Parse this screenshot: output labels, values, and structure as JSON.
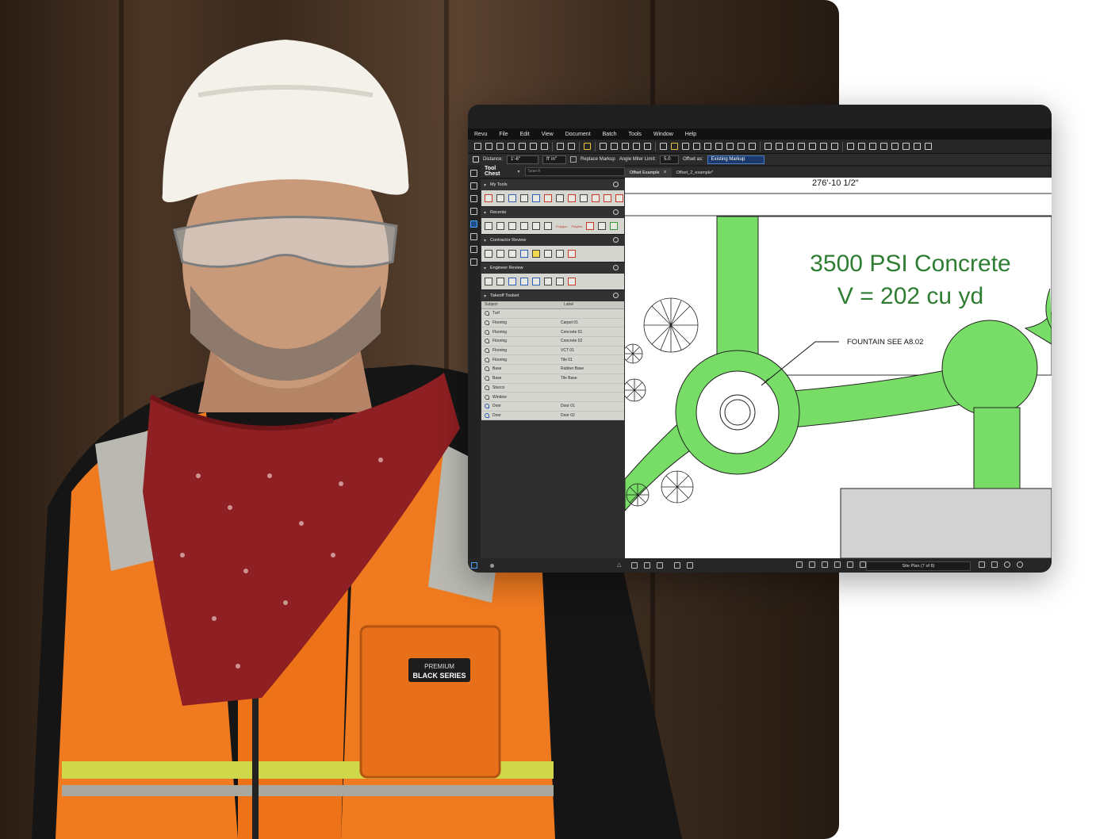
{
  "menu": [
    "Revu",
    "File",
    "Edit",
    "View",
    "Document",
    "Batch",
    "Tools",
    "Window",
    "Help"
  ],
  "options_bar": {
    "distance_label": "Distance:",
    "distance_value": "1'-6\"",
    "unit_value": "ft' in\"",
    "replace_markup_label": "Replace Markup",
    "angle_miter_label": "Angle Miter Limit:",
    "angle_miter_value": "5.0",
    "offset_as_label": "Offset as:",
    "offset_as_value": "Existing Markup"
  },
  "tool_chest": {
    "title": "Tool Chest",
    "search_placeholder": "Search",
    "sections": {
      "my_tools": "My Tools",
      "recents": "Recents",
      "contractor_review": "Contractor Review",
      "engineer_review": "Engineer Review",
      "takeoff_toolset": "Takeoff Toolset"
    },
    "recents_labels": [
      "Polygon",
      "Polyline"
    ],
    "takeoff_columns": [
      "Subject",
      "Label"
    ],
    "takeoff_rows": [
      {
        "subject": "Turf",
        "label": ""
      },
      {
        "subject": "Flooring",
        "label": "Carpet 01"
      },
      {
        "subject": "Flooring",
        "label": "Concrete 01"
      },
      {
        "subject": "Flooring",
        "label": "Concrete 02"
      },
      {
        "subject": "Flooring",
        "label": "VCT 01"
      },
      {
        "subject": "Flooring",
        "label": "Tile 01"
      },
      {
        "subject": "Base",
        "label": "Rubber Base"
      },
      {
        "subject": "Base",
        "label": "Tile Base"
      },
      {
        "subject": "Stucco",
        "label": ""
      },
      {
        "subject": "Window",
        "label": ""
      },
      {
        "subject": "Door",
        "label": "Door 01"
      },
      {
        "subject": "Door",
        "label": "Door 02"
      }
    ]
  },
  "tabs": [
    {
      "label": "Offset Example",
      "active": true
    },
    {
      "label": "Offset_2_example*",
      "active": false
    }
  ],
  "drawing": {
    "dimension": "276'-10 1/2\"",
    "title_line1": "3500 PSI Concrete",
    "title_line2": "V = 202 cu yd",
    "callout": "FOUNTAIN SEE A8.02",
    "accent_green": "#77dd66",
    "text_green": "#2e7d32"
  },
  "status": {
    "page_label": "Site Plan (7 of 8)"
  },
  "photo": {
    "vest_badge_line1": "PREMIUM",
    "vest_badge_line2": "BLACK SERIES"
  }
}
